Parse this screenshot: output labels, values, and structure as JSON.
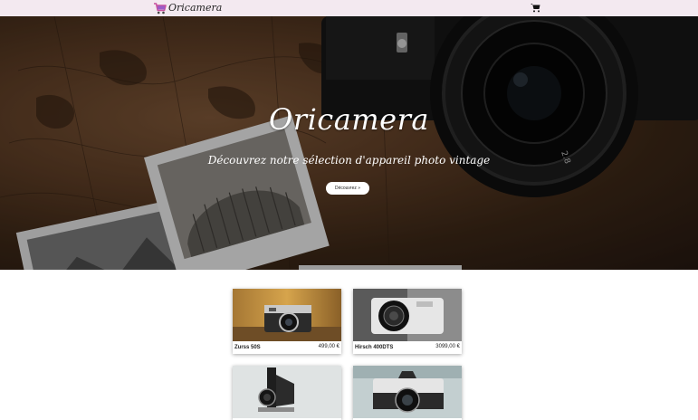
{
  "navbar": {
    "brand": "Oricamera",
    "logo_icon": "shopping-cart-logo-icon",
    "cart_icon": "shopping-cart-icon"
  },
  "hero": {
    "title": "Oricamera",
    "subtitle": "Découvrez notre sélection d'appareil photo vintage",
    "button_label": "Découvrez »"
  },
  "products": [
    {
      "name": "Zurss 50S",
      "price": "499,00 €"
    },
    {
      "name": "Hirsch 400DTS",
      "price": "3099,00 €"
    },
    {
      "name": "",
      "price": ""
    },
    {
      "name": "",
      "price": ""
    }
  ],
  "colors": {
    "navbar_bg": "#f3e9f0",
    "logo_accent": "#c84f9d"
  }
}
